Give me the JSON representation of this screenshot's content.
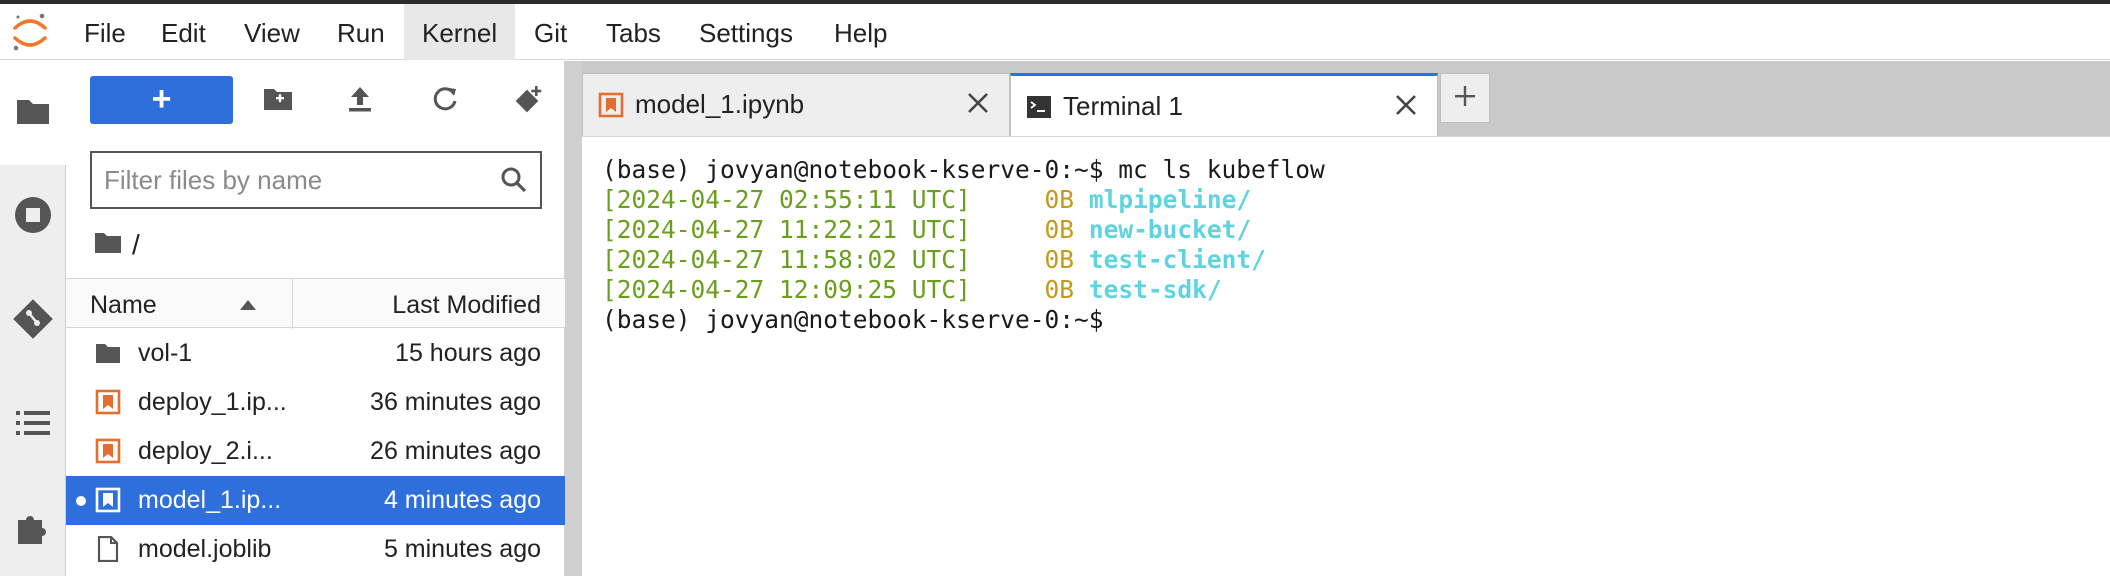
{
  "menubar": {
    "items": [
      "File",
      "Edit",
      "View",
      "Run",
      "Kernel",
      "Git",
      "Tabs",
      "Settings",
      "Help"
    ],
    "active": "Kernel"
  },
  "colors": {
    "accent": "#2f6fdb",
    "notebook_icon": "#e46e2e",
    "logo": "#f37726",
    "term_date": "#6a9f1e",
    "term_size": "#c49a1a",
    "term_dir": "#5fd3e0"
  },
  "rail": {
    "icons": [
      "folder-icon",
      "stop-circle-icon",
      "git-icon",
      "list-icon",
      "puzzle-icon"
    ]
  },
  "filebrowser": {
    "new_label": "+",
    "filter_placeholder": "Filter files by name",
    "breadcrumb": "/",
    "columns": {
      "name": "Name",
      "modified": "Last Modified"
    },
    "files": [
      {
        "name": "vol-1",
        "modified": "15 hours ago",
        "type": "folder",
        "selected": false
      },
      {
        "name": "deploy_1.ip...",
        "modified": "36 minutes ago",
        "type": "notebook",
        "selected": false
      },
      {
        "name": "deploy_2.i...",
        "modified": "26 minutes ago",
        "type": "notebook",
        "selected": false
      },
      {
        "name": "model_1.ip...",
        "modified": "4 minutes ago",
        "type": "notebook",
        "selected": true
      },
      {
        "name": "model.joblib",
        "modified": "5 minutes ago",
        "type": "file",
        "selected": false
      }
    ]
  },
  "tabs": [
    {
      "label": "model_1.ipynb",
      "active": false
    },
    {
      "label": "Terminal 1",
      "active": true
    }
  ],
  "terminal": {
    "prompt": "(base) jovyan@notebook-kserve-0:~$",
    "command": " mc ls kubeflow",
    "entries": [
      {
        "date": "[2024-04-27 02:55:11 UTC]",
        "size": "0B",
        "name": "mlpipeline/"
      },
      {
        "date": "[2024-04-27 11:22:21 UTC]",
        "size": "0B",
        "name": "new-bucket/"
      },
      {
        "date": "[2024-04-27 11:58:02 UTC]",
        "size": "0B",
        "name": "test-client/"
      },
      {
        "date": "[2024-04-27 12:09:25 UTC]",
        "size": "0B",
        "name": "test-sdk/"
      }
    ]
  }
}
